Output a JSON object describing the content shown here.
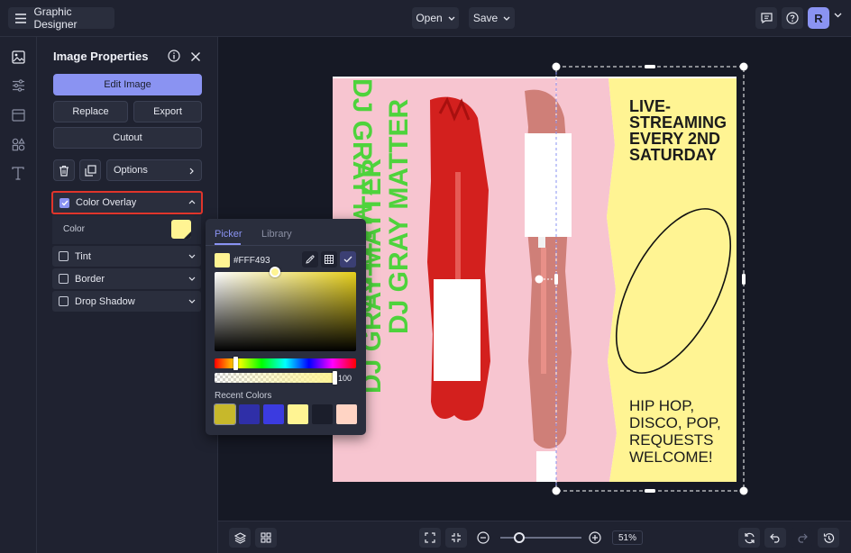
{
  "header": {
    "app_title": "Graphic Designer",
    "open_label": "Open",
    "save_label": "Save",
    "avatar_initial": "R"
  },
  "panel": {
    "title": "Image Properties",
    "edit_image": "Edit Image",
    "replace": "Replace",
    "export": "Export",
    "cutout": "Cutout",
    "options": "Options",
    "color_overlay": "Color Overlay",
    "color_label": "Color",
    "tint": "Tint",
    "border": "Border",
    "drop_shadow": "Drop Shadow"
  },
  "picker": {
    "tab_picker": "Picker",
    "tab_library": "Library",
    "hex_value": "#FFF493",
    "opacity_value": "100",
    "recent_colors_label": "Recent Colors",
    "recent_colors": [
      "#c7b82b",
      "#2f2fa8",
      "#3b3be0",
      "#fff493",
      "#1b1e2b",
      "#ffd4c4"
    ]
  },
  "poster": {
    "vertical_text_1": "DJ GRAY MATTER",
    "vertical_text_2": "DJ GRAY MATTER",
    "vertical_text_3": "DJ GRAY MATTER",
    "heading_line1": "LIVE-",
    "heading_line2": "STREAMING",
    "heading_line3": "EVERY 2ND",
    "heading_line4": "SATURDAY",
    "footer_line1": "HIP HOP,",
    "footer_line2": "DISCO, POP,",
    "footer_line3": "REQUESTS",
    "footer_line4": "WELCOME!"
  },
  "zoom": {
    "value": "51%",
    "level": 0.23
  },
  "colors": {
    "accent": "#8a93f2",
    "overlay_yellow": "#fff493",
    "poster_pink": "#f6c6cf",
    "poster_green": "#4ed33c",
    "highlight_red": "#e0352b"
  }
}
